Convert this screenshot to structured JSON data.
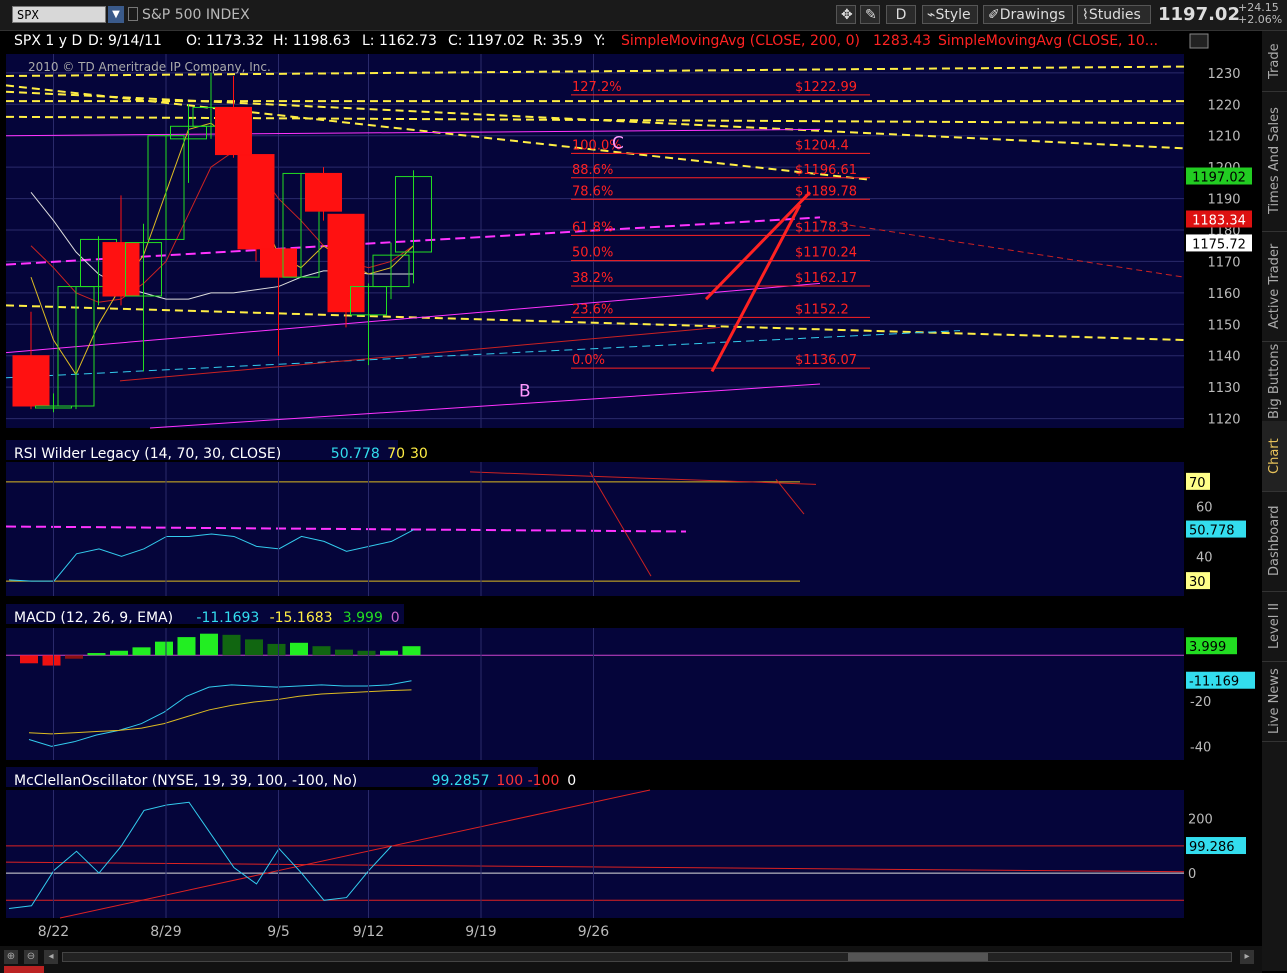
{
  "topbar": {
    "symbol": "SPX",
    "symbol_name": "S&P 500 INDEX",
    "period_button": "D",
    "style_label": "Style",
    "drawings_label": "Drawings",
    "studies_label": "Studies",
    "last_price": "1197.02",
    "net_change": "+24.15",
    "pct_change": "+2.06%"
  },
  "sidebar": {
    "tabs": [
      "Trade",
      "Times And Sales",
      "Active Trader",
      "Big Buttons",
      "Chart",
      "Dashboard",
      "Level II",
      "Live News"
    ]
  },
  "colors": {
    "bg": "#05053a",
    "grid": "#2a2a6a",
    "up": "#22dd22",
    "down": "#ff1111",
    "fib": "#ff2222",
    "trend_yellow": "#ffee44",
    "magenta": "#ff33ff",
    "cyan": "#33ccee"
  },
  "chart_data": [
    {
      "type": "candlestick",
      "header": {
        "symbol_period": "SPX 1 y D",
        "date": "D: 9/14/11",
        "open": "O: 1173.32",
        "high": "H: 1198.63",
        "low": "L: 1162.73",
        "close": "C: 1197.02",
        "range": "R: 35.9",
        "volume": "Y:",
        "sma200": "SimpleMovingAvg (CLOSE, 200, 0)",
        "sma200_value": "1283.43",
        "sma100": "SimpleMovingAvg (CLOSE, 10..."
      },
      "copyright": "2010 © TD Ameritrade IP Company, Inc.",
      "ylim": [
        1117,
        1236
      ],
      "y_ticks": [
        1120,
        1130,
        1140,
        1150,
        1160,
        1170,
        1180,
        1190,
        1200,
        1210,
        1220,
        1230
      ],
      "x_ticks": [
        "8/22",
        "8/29",
        "9/5",
        "9/12",
        "9/19",
        "9/26"
      ],
      "candles": [
        {
          "date": "8/19",
          "open": 1140,
          "high": 1154,
          "low": 1123,
          "close": 1124
        },
        {
          "date": "8/22",
          "open": 1124,
          "high": 1128,
          "low": 1122,
          "close": 1124
        },
        {
          "date": "8/23",
          "open": 1124,
          "high": 1162,
          "low": 1123,
          "close": 1162
        },
        {
          "date": "8/24",
          "open": 1162,
          "high": 1178,
          "low": 1156,
          "close": 1177
        },
        {
          "date": "8/25",
          "open": 1176,
          "high": 1191,
          "low": 1156,
          "close": 1159
        },
        {
          "date": "8/26",
          "open": 1159,
          "high": 1182,
          "low": 1135,
          "close": 1176
        },
        {
          "date": "8/29",
          "open": 1177,
          "high": 1210,
          "low": 1177,
          "close": 1210
        },
        {
          "date": "8/30",
          "open": 1209,
          "high": 1220,
          "low": 1195,
          "close": 1213
        },
        {
          "date": "8/31",
          "open": 1213,
          "high": 1230,
          "low": 1209,
          "close": 1219
        },
        {
          "date": "9/1",
          "open": 1219,
          "high": 1229,
          "low": 1203,
          "close": 1204
        },
        {
          "date": "9/2",
          "open": 1204,
          "high": 1204,
          "low": 1170,
          "close": 1174
        },
        {
          "date": "9/6",
          "open": 1174,
          "high": 1166,
          "low": 1140,
          "close": 1165
        },
        {
          "date": "9/7",
          "open": 1165,
          "high": 1198,
          "low": 1165,
          "close": 1198
        },
        {
          "date": "9/8",
          "open": 1198,
          "high": 1200,
          "low": 1183,
          "close": 1186
        },
        {
          "date": "9/9",
          "open": 1185,
          "high": 1185,
          "low": 1149,
          "close": 1154
        },
        {
          "date": "9/12",
          "open": 1153,
          "high": 1163,
          "low": 1137,
          "close": 1162
        },
        {
          "date": "9/13",
          "open": 1162,
          "high": 1176,
          "low": 1158,
          "close": 1172
        },
        {
          "date": "9/14",
          "open": 1173,
          "high": 1199,
          "low": 1163,
          "close": 1197
        }
      ],
      "fib_levels": [
        {
          "label": "127.2%",
          "price_label": "$1222.99",
          "value": 1222.99
        },
        {
          "label": "100.0%",
          "price_label": "$1204.4",
          "value": 1204.4
        },
        {
          "label": "88.6%",
          "price_label": "$1196.61",
          "value": 1196.61
        },
        {
          "label": "78.6%",
          "price_label": "$1189.78",
          "value": 1189.78
        },
        {
          "label": "61.8%",
          "price_label": "$1178.3",
          "value": 1178.3
        },
        {
          "label": "50.0%",
          "price_label": "$1170.24",
          "value": 1170.24
        },
        {
          "label": "38.2%",
          "price_label": "$1162.17",
          "value": 1162.17
        },
        {
          "label": "23.6%",
          "price_label": "$1152.2",
          "value": 1152.2
        },
        {
          "label": "0.0%",
          "price_label": "$1136.07",
          "value": 1136.07
        }
      ],
      "annotations": [
        "C",
        "B"
      ],
      "price_tags": [
        {
          "label": "1197.02",
          "value": 1197.02,
          "bg": "#22cc22",
          "fg": "#000"
        },
        {
          "label": "1183.34",
          "value": 1183.34,
          "bg": "#dd1111",
          "fg": "#fff"
        },
        {
          "label": "1175.72",
          "value": 1175.72,
          "bg": "#ffffff",
          "fg": "#000"
        }
      ]
    },
    {
      "type": "line",
      "title": "RSI Wilder Legacy (14, 70, 30, CLOSE)",
      "value_label": "50.778",
      "ob_label": "70",
      "os_label": "30",
      "ylim": [
        24,
        78
      ],
      "y_ticks": [
        60,
        40
      ],
      "values": [
        30.5,
        30,
        30,
        41,
        43,
        40,
        43,
        48,
        48,
        49,
        48,
        44,
        43,
        48,
        46,
        42,
        44,
        46,
        50.778
      ],
      "tags": [
        {
          "label": "70",
          "value": 70,
          "bg": "#ffff88",
          "fg": "#000"
        },
        {
          "label": "50.778",
          "value": 50.778,
          "bg": "#33ddee",
          "fg": "#000"
        },
        {
          "label": "30",
          "value": 30,
          "bg": "#ffff88",
          "fg": "#000"
        }
      ]
    },
    {
      "type": "bar",
      "title": "MACD (12, 26, 9, EMA)",
      "value_label": "-11.1693",
      "avg_label": "-15.1683",
      "diff_label": "3.999",
      "zero_label": "0",
      "ylim": [
        -46,
        12
      ],
      "y_ticks": [
        -20,
        -40
      ],
      "hist": [
        -3.5,
        -4.5,
        -1.5,
        1,
        2,
        3.5,
        6,
        8,
        9.5,
        9,
        7,
        5,
        5.5,
        4,
        2.5,
        2,
        2,
        3.999
      ],
      "macd": [
        -37,
        -40,
        -38,
        -35,
        -33,
        -30,
        -25,
        -18,
        -14,
        -13,
        -13.5,
        -14,
        -13.5,
        -13,
        -13.5,
        -13.5,
        -13,
        -11.1693
      ],
      "signal": [
        -34,
        -34.5,
        -34,
        -33.5,
        -33,
        -32,
        -30,
        -27,
        -24,
        -22,
        -20.5,
        -19.5,
        -18,
        -17,
        -16.5,
        -16,
        -15.5,
        -15.1683
      ],
      "tags": [
        {
          "label": "3.999",
          "value": 3.999,
          "bg": "#22dd22",
          "fg": "#000"
        },
        {
          "label": "-11.169",
          "value": -11.169,
          "bg": "#33ddee",
          "fg": "#000"
        }
      ]
    },
    {
      "type": "line",
      "title": "McClellanOscillator (NYSE, 19, 39, 100, -100, No)",
      "value_label": "99.2857",
      "hi_label": "100",
      "lo_label": "-100",
      "zero_label": "0",
      "ylim": [
        -165,
        305
      ],
      "y_ticks": [
        200,
        0
      ],
      "values": [
        -130,
        -120,
        10,
        80,
        0,
        100,
        230,
        250,
        260,
        140,
        20,
        -40,
        90,
        0,
        -100,
        -90,
        10,
        99.2857
      ],
      "tags": [
        {
          "label": "99.286",
          "value": 99.286,
          "bg": "#33ddee",
          "fg": "#000"
        }
      ]
    }
  ]
}
